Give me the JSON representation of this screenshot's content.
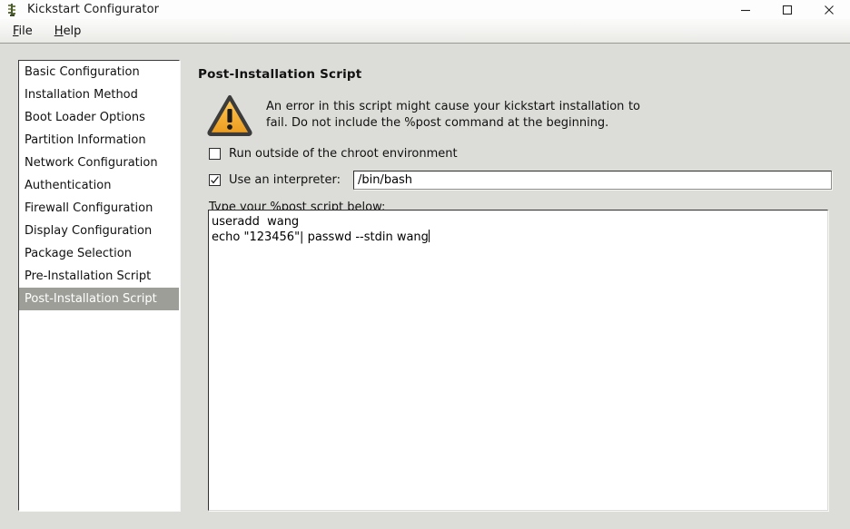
{
  "window": {
    "title": "Kickstart Configurator",
    "icon": "app-icon",
    "controls": {
      "minimize": "minimize-icon",
      "maximize": "maximize-icon",
      "close": "close-icon"
    }
  },
  "menubar": {
    "items": [
      {
        "label": "File",
        "accel": "F"
      },
      {
        "label": "Help",
        "accel": "H"
      }
    ]
  },
  "sidebar": {
    "items": [
      {
        "label": "Basic Configuration",
        "selected": false
      },
      {
        "label": "Installation Method",
        "selected": false
      },
      {
        "label": "Boot Loader Options",
        "selected": false
      },
      {
        "label": "Partition Information",
        "selected": false
      },
      {
        "label": "Network Configuration",
        "selected": false
      },
      {
        "label": "Authentication",
        "selected": false
      },
      {
        "label": "Firewall Configuration",
        "selected": false
      },
      {
        "label": "Display Configuration",
        "selected": false
      },
      {
        "label": "Package Selection",
        "selected": false
      },
      {
        "label": "Pre-Installation Script",
        "selected": false
      },
      {
        "label": "Post-Installation Script",
        "selected": true
      }
    ]
  },
  "main": {
    "page_title": "Post-Installation Script",
    "warning": {
      "icon": "warning-triangle-icon",
      "text": "An error in this script might cause your kickstart installation to fail. Do not include the %post command at the beginning."
    },
    "chroot_checkbox": {
      "label": "Run outside of the chroot environment",
      "checked": false
    },
    "interpreter_checkbox": {
      "label": "Use an interpreter:",
      "checked": true
    },
    "interpreter_input": {
      "value": "/bin/bash",
      "placeholder": ""
    },
    "script_label": "Type your %post script below:",
    "script_text": "useradd  wang\necho \"123456\"| passwd --stdin wang"
  },
  "colors": {
    "window_background": "#dcdcd8",
    "titlebar_background": "#fdfdfd",
    "selection_background": "#9e9e99",
    "selection_text": "#ffffff",
    "field_background": "#ffffff",
    "warning_icon_fill": "#f5a623",
    "text": "#111111"
  }
}
